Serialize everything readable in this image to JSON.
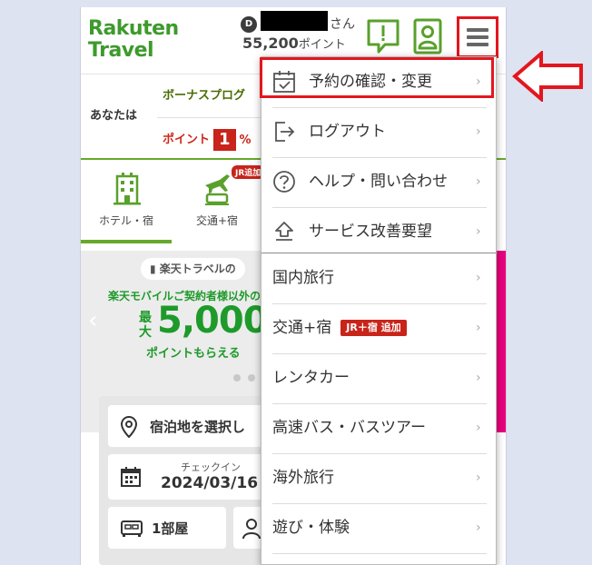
{
  "header": {
    "logo_line1": "Rakuten",
    "logo_line2": "Travel",
    "rank_badge": "D",
    "user_suffix": "さん",
    "points_value": "55,200",
    "points_unit": "ポイント"
  },
  "promo": {
    "label": "あなたは",
    "bonus": "ボーナスプログ",
    "point_text": "ポイント",
    "point_number": "1",
    "point_pct": "%"
  },
  "tabs": [
    {
      "label": "ホテル・宿",
      "active": true
    },
    {
      "label": "交通+宿",
      "active": false
    }
  ],
  "tab_badge": "JR追加",
  "banner": {
    "tag": "楽天トラベルの",
    "subtitle": "楽天モバイルご契約者様以外の",
    "max_label": "最大",
    "amount": "5,000",
    "get_text": "ポイントもらえる",
    "prev_arrow": "‹"
  },
  "search": {
    "destination": "宿泊地を選択し",
    "checkin_label": "チェックイン",
    "checkin_date": "2024/03/16",
    "rooms": "1部屋"
  },
  "menu": {
    "items": [
      {
        "label": "予約の確認・変更"
      },
      {
        "label": "ログアウト"
      },
      {
        "label": "ヘルプ・問い合わせ"
      },
      {
        "label": "サービス改善要望"
      },
      {
        "label": "国内旅行"
      },
      {
        "label": "交通+宿",
        "badge": "JR＋宿 追加"
      },
      {
        "label": "レンタカー"
      },
      {
        "label": "高速バス・バスツアー"
      },
      {
        "label": "海外旅行"
      },
      {
        "label": "遊び・体験"
      }
    ],
    "chevron": "›"
  },
  "colors": {
    "brand_green": "#3e9a2d",
    "annotation_red": "#e3161e",
    "badge_red": "#c8241a",
    "background": "#dde3f1"
  }
}
